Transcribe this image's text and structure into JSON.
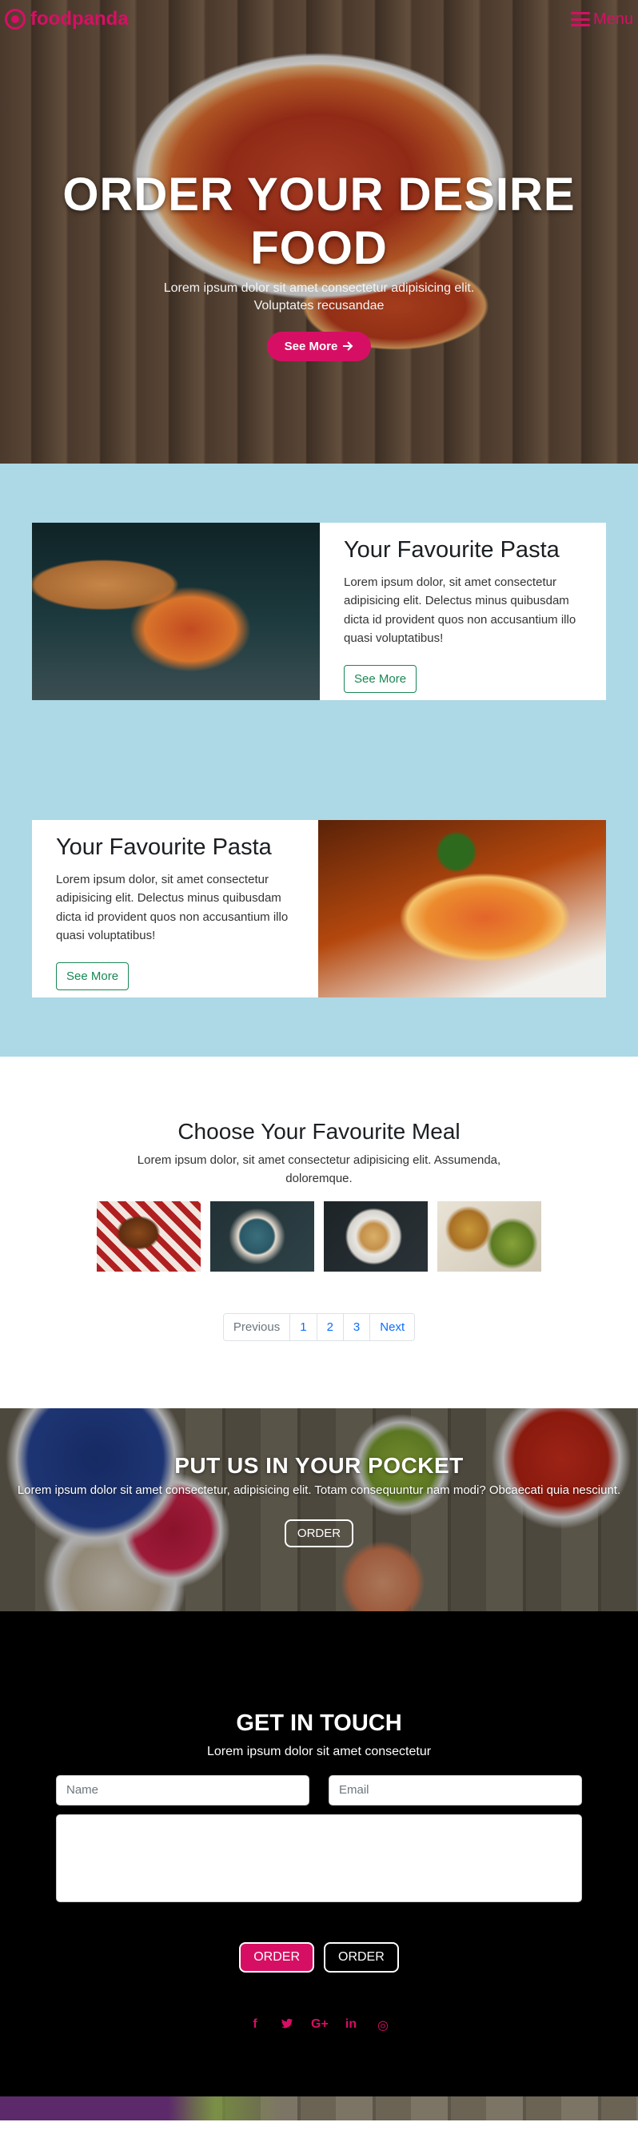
{
  "navbar": {
    "brand": "foodpanda",
    "menu_label": "Menu"
  },
  "hero": {
    "title": "ORDER YOUR DESIRE FOOD",
    "subtitle": "Lorem ipsum dolor sit amet consectetur adipisicing elit. Voluptates recusandae",
    "button_label": "See More",
    "button_icon": "arrow-right-icon"
  },
  "pasta": {
    "cards": [
      {
        "title": "Your Favourite Pasta",
        "text": "Lorem ipsum dolor, sit amet consectetur adipisicing elit. Delectus minus quibusdam dicta id provident quos non accusantium illo quasi voluptatibus!",
        "button_label": "See More",
        "image": "spaghetti-with-bread"
      },
      {
        "title": "Your Favourite Pasta",
        "text": "Lorem ipsum dolor, sit amet consectetur adipisicing elit. Delectus minus quibusdam dicta id provident quos non accusantium illo quasi voluptatibus!",
        "button_label": "See More",
        "image": "penne-with-basil"
      }
    ]
  },
  "meal": {
    "title": "Choose Your Favourite Meal",
    "subtitle": "Lorem ipsum dolor, sit amet consectetur adipisicing elit. Assumenda, doloremque.",
    "thumbnails": [
      "burger-platter",
      "coffee-cup",
      "plated-dish",
      "tartlets"
    ],
    "pagination": {
      "previous": "Previous",
      "pages": [
        "1",
        "2",
        "3"
      ],
      "next": "Next"
    }
  },
  "pocket": {
    "title": "PUT US IN YOUR POCKET",
    "text": "Lorem ipsum dolor sit amet consectetur, adipisicing elit. Totam consequuntur nam modi? Obcaecati quia nesciunt.",
    "button_label": "ORDER"
  },
  "contact": {
    "title": "GET IN TOUCH",
    "subtitle": "Lorem ipsum dolor sit amet consectetur",
    "name_placeholder": "Name",
    "email_placeholder": "Email",
    "primary_button": "ORDER",
    "secondary_button": "ORDER",
    "socials": [
      {
        "icon": "facebook-icon",
        "glyph": "f"
      },
      {
        "icon": "twitter-icon",
        "glyph": "t"
      },
      {
        "icon": "google-plus-icon",
        "glyph": "G+"
      },
      {
        "icon": "linkedin-icon",
        "glyph": "in"
      },
      {
        "icon": "dribbble-icon",
        "glyph": "◎"
      }
    ]
  },
  "colors": {
    "brand_pink": "#d70f64",
    "pasta_bg": "#add8e6",
    "outline_green": "#198754",
    "link_blue": "#0d6efd"
  }
}
